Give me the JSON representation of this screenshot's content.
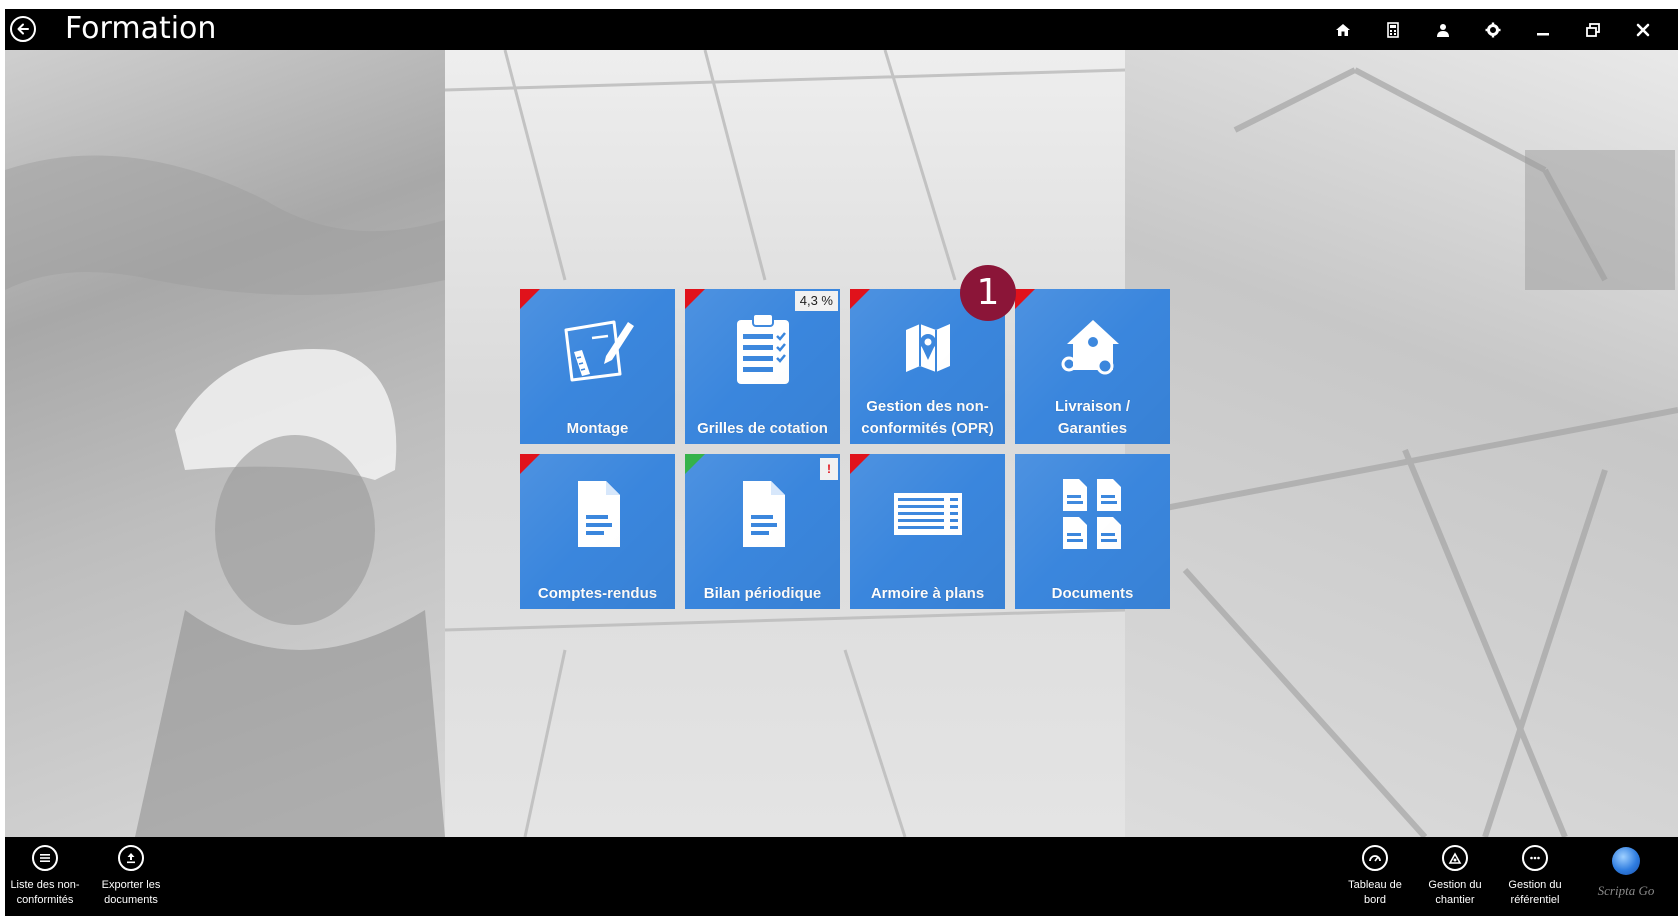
{
  "window": {
    "title": "Formation",
    "back_icon": "back-arrow-icon",
    "controls": [
      {
        "name": "home-icon"
      },
      {
        "name": "calculator-icon"
      },
      {
        "name": "user-icon"
      },
      {
        "name": "settings-gear-icon"
      },
      {
        "name": "minimize-icon"
      },
      {
        "name": "restore-icon"
      },
      {
        "name": "close-icon"
      }
    ]
  },
  "tiles": [
    {
      "label": "Montage",
      "icon": "drawing-pencil-icon",
      "corner": "red"
    },
    {
      "label": "Grilles de cotation",
      "icon": "clipboard-checklist-icon",
      "corner": "red",
      "badge": "4,3 %"
    },
    {
      "label_line1": "Gestion des non-",
      "label_line2": "conformités (OPR)",
      "icon": "map-pin-icon",
      "corner": "red"
    },
    {
      "label_line1": "Livraison /",
      "label_line2": "Garanties",
      "icon": "house-key-icon",
      "corner": "red"
    },
    {
      "label": "Comptes-rendus",
      "icon": "document-icon",
      "corner": "red"
    },
    {
      "label": "Bilan périodique",
      "icon": "document-icon",
      "corner": "green",
      "alert": "!"
    },
    {
      "label": "Armoire à plans",
      "icon": "plan-cabinet-icon",
      "corner": "red"
    },
    {
      "label": "Documents",
      "icon": "documents-grid-icon"
    }
  ],
  "step_marker": "1",
  "bottom_left": [
    {
      "line1": "Liste des non-",
      "line2": "conformités",
      "icon": "list-icon"
    },
    {
      "line1": "Exporter les",
      "line2": "documents",
      "icon": "export-upload-icon"
    }
  ],
  "bottom_right": [
    {
      "line1": "Tableau de",
      "line2": "bord",
      "icon": "dashboard-icon"
    },
    {
      "line1": "Gestion du",
      "line2": "chantier",
      "icon": "site-management-icon"
    },
    {
      "line1": "Gestion du",
      "line2": "référentiel",
      "icon": "more-dots-icon"
    }
  ],
  "brand": {
    "text": "Scripta Go",
    "icon": "globe-logo-icon"
  },
  "colors": {
    "tile_blue": "#3a86dd",
    "corner_red": "#e0121b",
    "corner_green": "#35b24a",
    "marker": "#8b1538",
    "bar_black": "#000000"
  }
}
